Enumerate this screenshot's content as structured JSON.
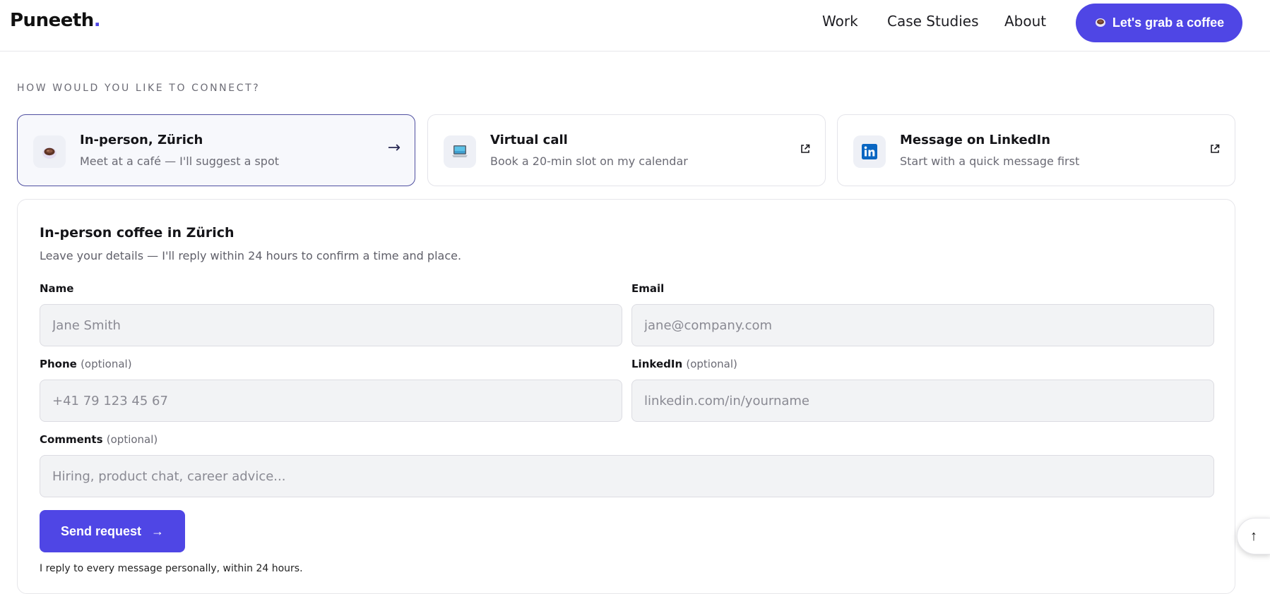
{
  "header": {
    "logo_text": "Puneeth",
    "logo_dot": ".",
    "nav": [
      {
        "label": "Work"
      },
      {
        "label": "Case Studies"
      },
      {
        "label": "About"
      }
    ],
    "cta_label": "Let's grab a coffee",
    "cta_icon": "coffee-cup-icon",
    "accent_color": "#4f46e5"
  },
  "connect": {
    "heading": "HOW WOULD YOU LIKE TO CONNECT?",
    "options": [
      {
        "title": "In-person, Zürich",
        "subtitle": "Meet at a café — I'll suggest a spot",
        "icon": "coffee-cup-icon",
        "trailing": "→",
        "active": true
      },
      {
        "title": "Virtual call",
        "subtitle": "Book a 20-min slot on my calendar",
        "icon": "laptop-icon",
        "trailing_icon": "external-link-icon",
        "active": false
      },
      {
        "title": "Message on LinkedIn",
        "subtitle": "Start with a quick message first",
        "icon": "linkedin-icon",
        "trailing_icon": "external-link-icon",
        "active": false
      }
    ]
  },
  "form": {
    "title": "In-person coffee in Zürich",
    "subtitle": "Leave your details — I'll reply within 24 hours to confirm a time and place.",
    "fields": {
      "name": {
        "label": "Name",
        "placeholder": "Jane Smith",
        "value": ""
      },
      "email": {
        "label": "Email",
        "placeholder": "jane@company.com",
        "value": ""
      },
      "phone": {
        "label": "Phone",
        "note": "(optional)",
        "placeholder": "+41 79 123 45 67",
        "value": ""
      },
      "linkedin": {
        "label": "LinkedIn",
        "note": "(optional)",
        "placeholder": "linkedin.com/in/yourname",
        "value": ""
      },
      "comments": {
        "label": "Comments",
        "note": "(optional)",
        "placeholder": "Hiring, product chat, career advice...",
        "value": ""
      }
    },
    "submit_label": "Send request",
    "submit_icon": "→",
    "footnote": "I reply to every message personally, within 24 hours."
  },
  "scroll_top_icon": "↑"
}
